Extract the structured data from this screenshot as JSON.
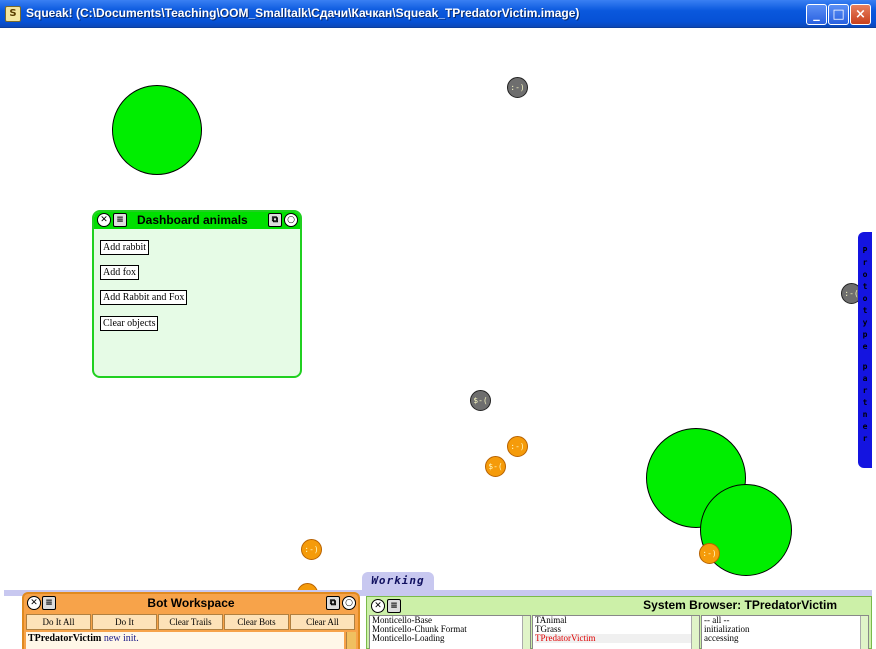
{
  "window": {
    "title": "Squeak! (C:\\Documents\\Teaching\\OOM_Smalltalk\\Сдачи\\Качкан\\Squeak_TPredatorVictim.image)",
    "minimize": "_",
    "maximize": "□",
    "close": "×"
  },
  "dashboard": {
    "title": "Dashboard animals",
    "buttons": [
      "Add rabbit",
      "Add fox",
      "Add Rabbit and Fox",
      "Clear objects"
    ]
  },
  "animals": {
    "rabbit_face": ":-)",
    "rabbit_sad_face": ":-(",
    "fox_face": ":-)",
    "fox_hungry_face": "$-("
  },
  "flap": {
    "label": "Prototype partner",
    "letters": [
      "P",
      "r",
      "o",
      "t",
      "o",
      "t",
      "y",
      "p",
      "e",
      "",
      "p",
      "a",
      "r",
      "t",
      "n",
      "e",
      "r"
    ]
  },
  "working_tab": {
    "label": "Working"
  },
  "workspace": {
    "title": "Bot Workspace",
    "buttons": [
      "Do It All",
      "Do It",
      "Clear Trails",
      "Clear Bots",
      "Clear All"
    ],
    "code_class": "TPredatorVictim",
    "code_rest": " new init."
  },
  "browser": {
    "title": "System Browser: TPredatorVictim",
    "packages": [
      "Monticello-Base",
      "Monticello-Chunk Format",
      "Monticello-Loading"
    ],
    "classes": [
      "TAnimal",
      "TGrass",
      "TPredatorVictim"
    ],
    "protocols": [
      "-- all --",
      "initialization",
      "accessing"
    ]
  },
  "colors": {
    "grass": "#00ee00",
    "fox": "#f59b0a",
    "rabbit": "#6e6e6e",
    "flap": "#1414e0",
    "dashboard_title": "#00e000",
    "workspace": "#f7a34a",
    "browser": "#ccf0a8"
  }
}
